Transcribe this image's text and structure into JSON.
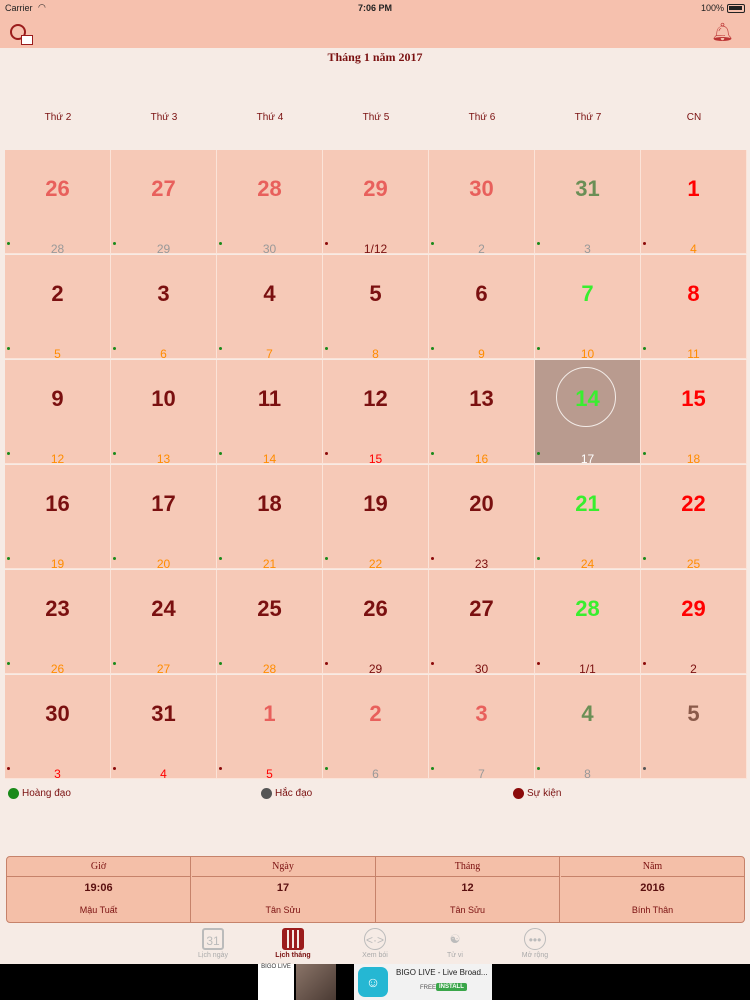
{
  "status_bar": {
    "carrier": "Carrier",
    "time": "7:06 PM",
    "battery": "100%"
  },
  "header": {
    "title": "Tháng 1 năm 2017",
    "left_icon": "calendar-settings-icon",
    "right_icon": "bell-icon"
  },
  "weekdays": [
    "Thứ 2",
    "Thứ 3",
    "Thứ 4",
    "Thứ 5",
    "Thứ 6",
    "Thứ 7",
    "CN"
  ],
  "colors": {
    "accent": "#9b1c1c",
    "dark_red": "#7a1010",
    "current_day": "#5a0f0f",
    "other_month": "#e8605c",
    "sunday": "#ff0000",
    "saturday": "#39ee2f",
    "lunar": "#ff8c00",
    "hoang_dao": "#1a8a1a",
    "hac_dao": "#555555",
    "su_kien": "#8b0a0a"
  },
  "calendar": {
    "selected_day": "14",
    "weeks": [
      [
        {
          "solar": "26",
          "lunar": "28",
          "color": "#e8605c",
          "lcolor": "#999999",
          "dot": "#1a8a1a"
        },
        {
          "solar": "27",
          "lunar": "29",
          "color": "#e8605c",
          "lcolor": "#999999",
          "dot": "#1a8a1a"
        },
        {
          "solar": "28",
          "lunar": "30",
          "color": "#e8605c",
          "lcolor": "#999999",
          "dot": "#1a8a1a"
        },
        {
          "solar": "29",
          "lunar": "1/12",
          "color": "#e8605c",
          "lcolor": "#7a1010",
          "dot": "#8b0a0a"
        },
        {
          "solar": "30",
          "lunar": "2",
          "color": "#e8605c",
          "lcolor": "#999999",
          "dot": "#1a8a1a"
        },
        {
          "solar": "31",
          "lunar": "3",
          "color": "#6b8f56",
          "lcolor": "#999999",
          "dot": "#1a8a1a"
        },
        {
          "solar": "1",
          "lunar": "4",
          "color": "#ff0000",
          "lcolor": "#ff8c00",
          "dot": "#8b0a0a"
        }
      ],
      [
        {
          "solar": "2",
          "lunar": "5",
          "color": "#7a1010",
          "lcolor": "#ff8c00",
          "dot": "#1a8a1a"
        },
        {
          "solar": "3",
          "lunar": "6",
          "color": "#7a1010",
          "lcolor": "#ff8c00",
          "dot": "#1a8a1a"
        },
        {
          "solar": "4",
          "lunar": "7",
          "color": "#7a1010",
          "lcolor": "#ff8c00",
          "dot": "#1a8a1a"
        },
        {
          "solar": "5",
          "lunar": "8",
          "color": "#7a1010",
          "lcolor": "#ff8c00",
          "dot": "#1a8a1a"
        },
        {
          "solar": "6",
          "lunar": "9",
          "color": "#7a1010",
          "lcolor": "#ff8c00",
          "dot": "#1a8a1a"
        },
        {
          "solar": "7",
          "lunar": "10",
          "color": "#39ee2f",
          "lcolor": "#ff8c00",
          "dot": "#1a8a1a"
        },
        {
          "solar": "8",
          "lunar": "11",
          "color": "#ff0000",
          "lcolor": "#ff8c00",
          "dot": "#1a8a1a"
        }
      ],
      [
        {
          "solar": "9",
          "lunar": "12",
          "color": "#7a1010",
          "lcolor": "#ff8c00",
          "dot": "#1a8a1a"
        },
        {
          "solar": "10",
          "lunar": "13",
          "color": "#7a1010",
          "lcolor": "#ff8c00",
          "dot": "#1a8a1a"
        },
        {
          "solar": "11",
          "lunar": "14",
          "color": "#7a1010",
          "lcolor": "#ff8c00",
          "dot": "#1a8a1a"
        },
        {
          "solar": "12",
          "lunar": "15",
          "color": "#7a1010",
          "lcolor": "#ff0000",
          "dot": "#8b0a0a"
        },
        {
          "solar": "13",
          "lunar": "16",
          "color": "#7a1010",
          "lcolor": "#ff8c00",
          "dot": "#1a8a1a"
        },
        {
          "solar": "14",
          "lunar": "17",
          "color": "#39ee2f",
          "lcolor": "#ffffff",
          "dot": "#1a8a1a"
        },
        {
          "solar": "15",
          "lunar": "18",
          "color": "#ff0000",
          "lcolor": "#ff8c00",
          "dot": "#1a8a1a"
        }
      ],
      [
        {
          "solar": "16",
          "lunar": "19",
          "color": "#7a1010",
          "lcolor": "#ff8c00",
          "dot": "#1a8a1a"
        },
        {
          "solar": "17",
          "lunar": "20",
          "color": "#7a1010",
          "lcolor": "#ff8c00",
          "dot": "#1a8a1a"
        },
        {
          "solar": "18",
          "lunar": "21",
          "color": "#7a1010",
          "lcolor": "#ff8c00",
          "dot": "#1a8a1a"
        },
        {
          "solar": "19",
          "lunar": "22",
          "color": "#7a1010",
          "lcolor": "#ff8c00",
          "dot": "#1a8a1a"
        },
        {
          "solar": "20",
          "lunar": "23",
          "color": "#7a1010",
          "lcolor": "#7a1010",
          "dot": "#8b0a0a"
        },
        {
          "solar": "21",
          "lunar": "24",
          "color": "#39ee2f",
          "lcolor": "#ff8c00",
          "dot": "#1a8a1a"
        },
        {
          "solar": "22",
          "lunar": "25",
          "color": "#ff0000",
          "lcolor": "#ff8c00",
          "dot": "#1a8a1a"
        }
      ],
      [
        {
          "solar": "23",
          "lunar": "26",
          "color": "#7a1010",
          "lcolor": "#ff8c00",
          "dot": "#1a8a1a"
        },
        {
          "solar": "24",
          "lunar": "27",
          "color": "#7a1010",
          "lcolor": "#ff8c00",
          "dot": "#1a8a1a"
        },
        {
          "solar": "25",
          "lunar": "28",
          "color": "#7a1010",
          "lcolor": "#ff8c00",
          "dot": "#1a8a1a"
        },
        {
          "solar": "26",
          "lunar": "29",
          "color": "#7a1010",
          "lcolor": "#7a1010",
          "dot": "#8b0a0a"
        },
        {
          "solar": "27",
          "lunar": "30",
          "color": "#7a1010",
          "lcolor": "#7a1010",
          "dot": "#8b0a0a"
        },
        {
          "solar": "28",
          "lunar": "1/1",
          "color": "#39ee2f",
          "lcolor": "#7a1010",
          "dot": "#8b0a0a"
        },
        {
          "solar": "29",
          "lunar": "2",
          "color": "#ff0000",
          "lcolor": "#7a1010",
          "dot": "#8b0a0a"
        }
      ],
      [
        {
          "solar": "30",
          "lunar": "3",
          "color": "#7a1010",
          "lcolor": "#ff0000",
          "dot": "#8b0a0a"
        },
        {
          "solar": "31",
          "lunar": "4",
          "color": "#7a1010",
          "lcolor": "#ff0000",
          "dot": "#8b0a0a"
        },
        {
          "solar": "1",
          "lunar": "5",
          "color": "#e8605c",
          "lcolor": "#ff0000",
          "dot": "#8b0a0a"
        },
        {
          "solar": "2",
          "lunar": "6",
          "color": "#e8605c",
          "lcolor": "#999999",
          "dot": "#1a8a1a"
        },
        {
          "solar": "3",
          "lunar": "7",
          "color": "#e8605c",
          "lcolor": "#999999",
          "dot": "#1a8a1a"
        },
        {
          "solar": "4",
          "lunar": "8",
          "color": "#6b8f56",
          "lcolor": "#999999",
          "dot": "#1a8a1a"
        },
        {
          "solar": "5",
          "lunar": "",
          "color": "#8a5a4a",
          "lcolor": "#999999",
          "dot": "#555555"
        }
      ]
    ]
  },
  "legend": [
    {
      "label": "Hoàng đạo",
      "color": "#1a8a1a"
    },
    {
      "label": "Hắc đạo",
      "color": "#555555"
    },
    {
      "label": "Sự kiện",
      "color": "#8b0a0a"
    }
  ],
  "info": [
    {
      "header": "Giờ",
      "value": "19:06",
      "sub": "Mậu Tuất"
    },
    {
      "header": "Ngày",
      "value": "17",
      "sub": "Tân Sửu"
    },
    {
      "header": "Tháng",
      "value": "12",
      "sub": "Tân Sửu"
    },
    {
      "header": "Năm",
      "value": "2016",
      "sub": "Bính Thân"
    }
  ],
  "tabs": [
    {
      "label": "Lịch ngày",
      "icon": "calendar-day-icon",
      "glyph": "31",
      "active": false
    },
    {
      "label": "Lịch tháng",
      "icon": "calendar-month-icon",
      "glyph": "",
      "active": true
    },
    {
      "label": "Xem bói",
      "icon": "fortune-eye-icon",
      "glyph": "<·>",
      "active": false
    },
    {
      "label": "Tử vi",
      "icon": "yin-yang-icon",
      "glyph": "☯",
      "active": false
    },
    {
      "label": "Mở rộng",
      "icon": "more-icon",
      "glyph": "•••",
      "active": false
    }
  ],
  "ad": {
    "title": "BIGO LIVE - Live Broad...",
    "price": "FREE",
    "install": "INSTALL",
    "logo_text": "BIGO LIVE"
  }
}
